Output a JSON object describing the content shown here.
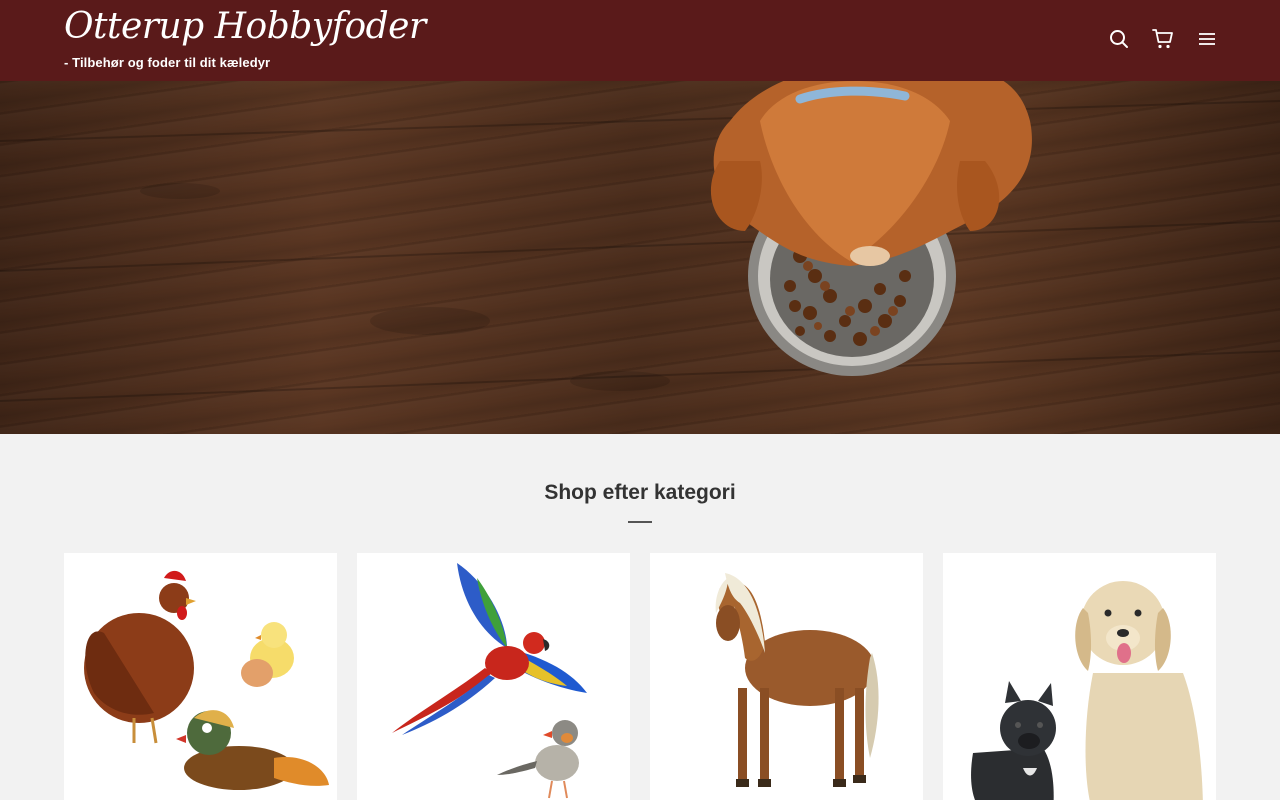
{
  "header": {
    "site_title": "Otterup Hobbyfoder",
    "tagline": "- Tilbehør og foder til dit kæledyr",
    "icons": [
      "search-icon",
      "cart-icon",
      "menu-icon"
    ],
    "background_color": "#5a1a1a"
  },
  "hero": {
    "image": "puppy-eating-from-bowl-on-wood-floor"
  },
  "categories_section": {
    "title": "Shop efter kategori",
    "cards": [
      {
        "image": "poultry-and-ducks"
      },
      {
        "image": "birds-parrot-finch"
      },
      {
        "image": "horse-pony"
      },
      {
        "image": "dogs"
      }
    ]
  }
}
